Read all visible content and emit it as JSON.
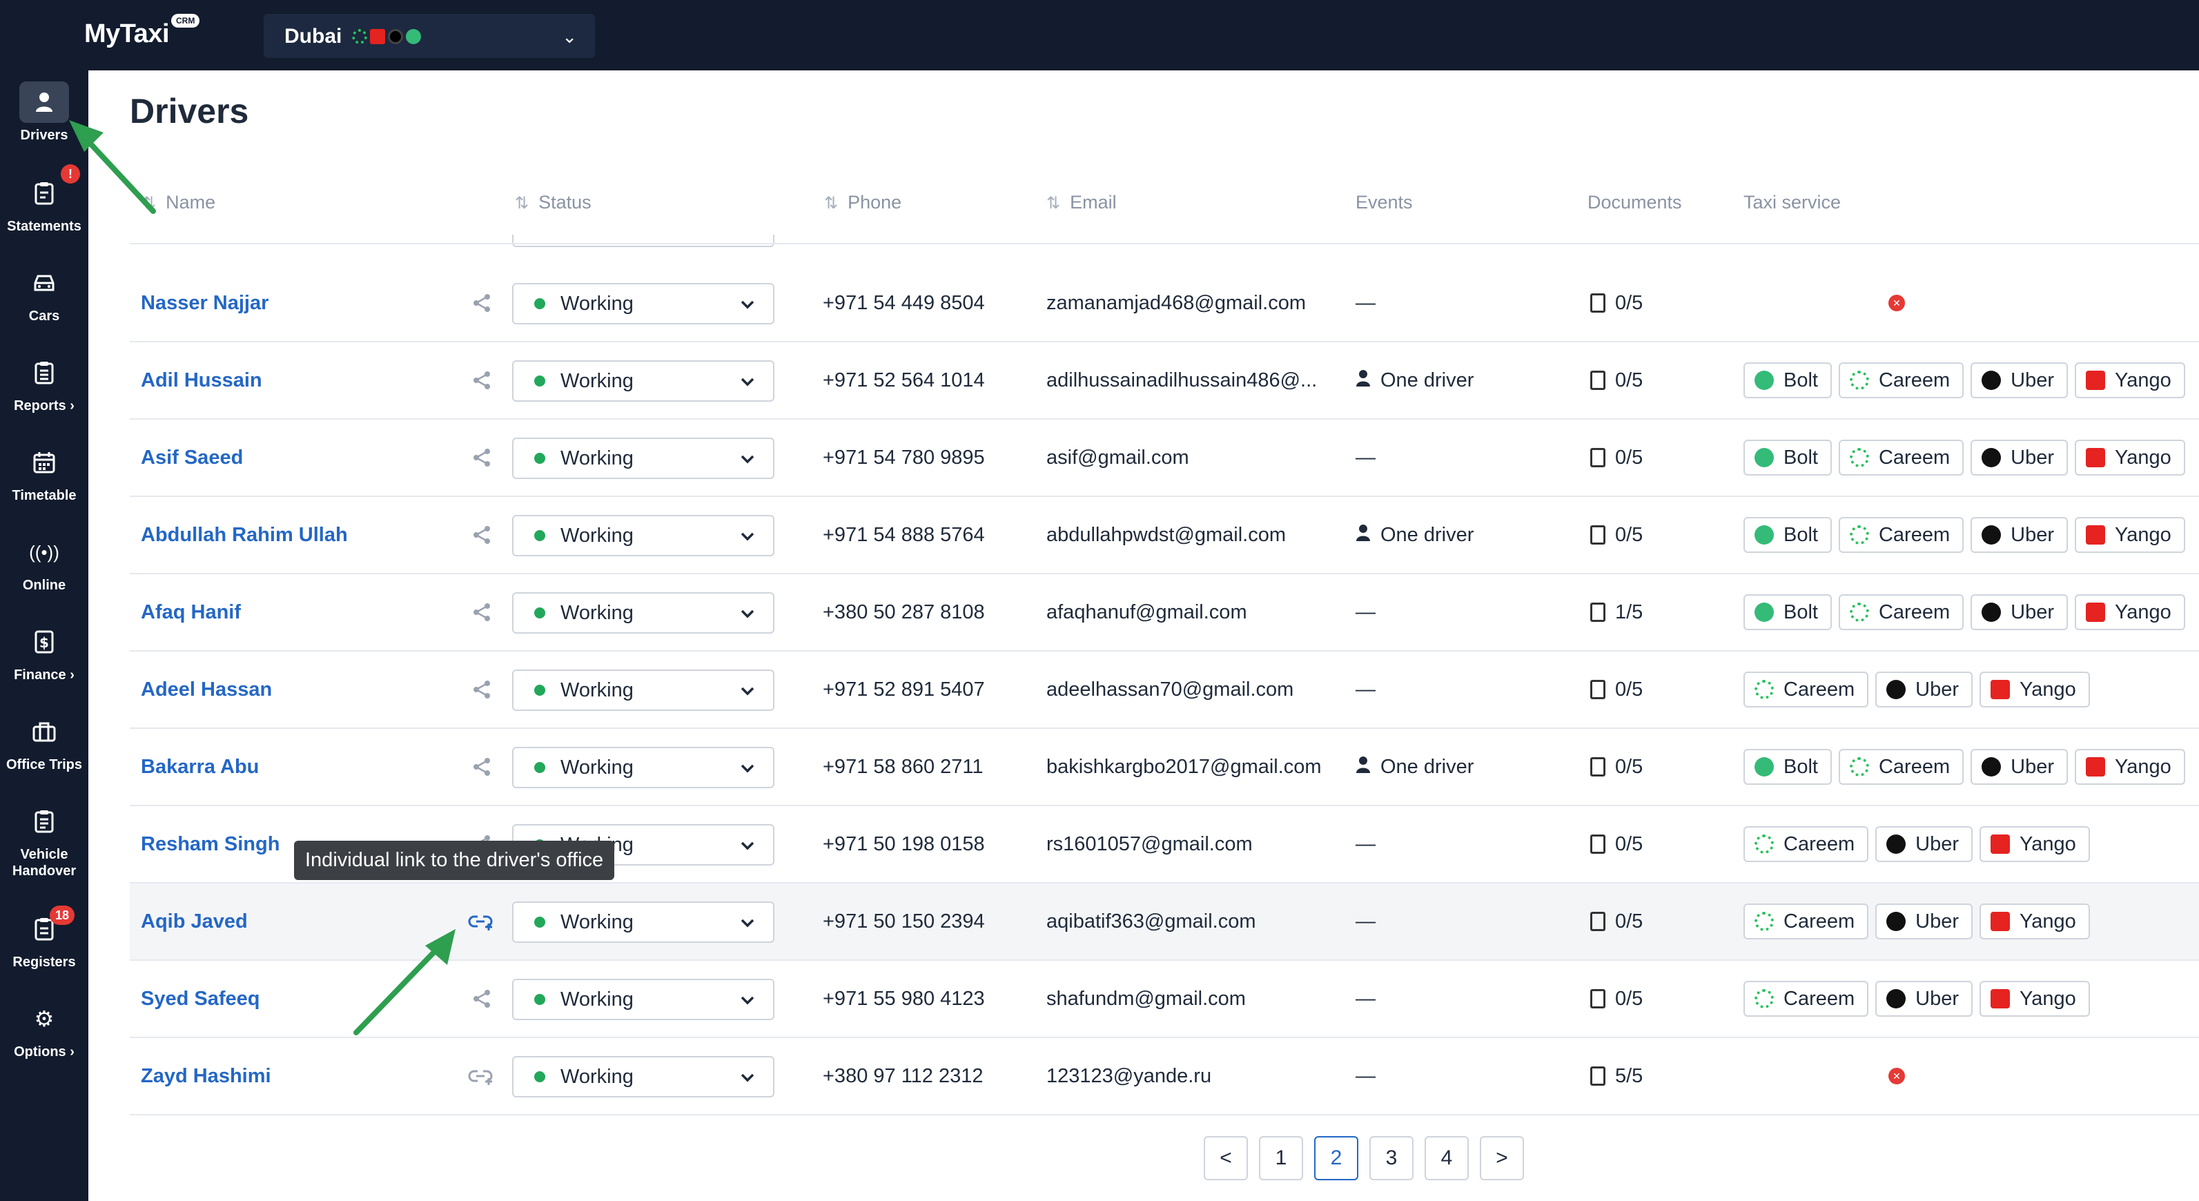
{
  "app": {
    "name": "MyTaxi",
    "badge": "CRM"
  },
  "city_selector": {
    "value": "Dubai"
  },
  "sidebar": {
    "items": [
      {
        "label": "Drivers",
        "icon": "person-icon"
      },
      {
        "label": "Statements",
        "icon": "clipboard-icon",
        "badge": "!"
      },
      {
        "label": "Cars",
        "icon": "car-icon"
      },
      {
        "label": "Reports ›",
        "icon": "report-icon"
      },
      {
        "label": "Timetable",
        "icon": "calendar-icon"
      },
      {
        "label": "Online",
        "icon": "broadcast-icon"
      },
      {
        "label": "Finance ›",
        "icon": "dollar-doc-icon"
      },
      {
        "label": "Office Trips",
        "icon": "briefcase-icon"
      },
      {
        "label": "Vehicle Handover",
        "icon": "clipboard-list-icon"
      },
      {
        "label": "Registers",
        "icon": "register-icon",
        "badge": "18"
      },
      {
        "label": "Options ›",
        "icon": "gear-icon"
      }
    ]
  },
  "page": {
    "title": "Drivers"
  },
  "table": {
    "headers": {
      "name": "Name",
      "status": "Status",
      "phone": "Phone",
      "email": "Email",
      "events": "Events",
      "documents": "Documents",
      "taxi": "Taxi service"
    },
    "rows": [
      {
        "name": "Nasser Najjar",
        "status": "Working",
        "phone": "+971 54 449 8504",
        "email": "zamanamjad468@gmail.com",
        "events": "—",
        "docs": "0/5",
        "services": []
      },
      {
        "name": "Adil Hussain",
        "status": "Working",
        "phone": "+971 52 564 1014",
        "email": "adilhussainadilhussain486@...",
        "events": "One driver",
        "docs": "0/5",
        "services": [
          "Bolt",
          "Careem",
          "Uber",
          "Yango"
        ]
      },
      {
        "name": "Asif Saeed",
        "status": "Working",
        "phone": "+971 54 780 9895",
        "email": "asif@gmail.com",
        "events": "—",
        "docs": "0/5",
        "services": [
          "Bolt",
          "Careem",
          "Uber",
          "Yango"
        ]
      },
      {
        "name": "Abdullah Rahim Ullah",
        "status": "Working",
        "phone": "+971 54 888 5764",
        "email": "abdullahpwdst@gmail.com",
        "events": "One driver",
        "docs": "0/5",
        "services": [
          "Bolt",
          "Careem",
          "Uber",
          "Yango"
        ]
      },
      {
        "name": "Afaq Hanif",
        "status": "Working",
        "phone": "+380 50 287 8108",
        "email": "afaqhanuf@gmail.com",
        "events": "—",
        "docs": "1/5",
        "services": [
          "Bolt",
          "Careem",
          "Uber",
          "Yango"
        ]
      },
      {
        "name": "Adeel Hassan",
        "status": "Working",
        "phone": "+971 52 891 5407",
        "email": "adeelhassan70@gmail.com",
        "events": "—",
        "docs": "0/5",
        "services": [
          "Careem",
          "Uber",
          "Yango"
        ]
      },
      {
        "name": "Bakarra Abu",
        "status": "Working",
        "phone": "+971 58 860 2711",
        "email": "bakishkargbo2017@gmail.com",
        "events": "One driver",
        "docs": "0/5",
        "services": [
          "Bolt",
          "Careem",
          "Uber",
          "Yango"
        ]
      },
      {
        "name": "Resham Singh",
        "status": "Working",
        "phone": "+971 50 198 0158",
        "email": "rs1601057@gmail.com",
        "events": "—",
        "docs": "0/5",
        "services": [
          "Careem",
          "Uber",
          "Yango"
        ]
      },
      {
        "name": "Aqib Javed",
        "status": "Working",
        "phone": "+971 50 150 2394",
        "email": "aqibatif363@gmail.com",
        "events": "—",
        "docs": "0/5",
        "services": [
          "Careem",
          "Uber",
          "Yango"
        ]
      },
      {
        "name": "Syed Safeeq",
        "status": "Working",
        "phone": "+971 55 980 4123",
        "email": "shafundm@gmail.com",
        "events": "—",
        "docs": "0/5",
        "services": [
          "Careem",
          "Uber",
          "Yango"
        ]
      },
      {
        "name": "Zayd Hashimi",
        "status": "Working",
        "phone": "+380 97 112 2312",
        "email": "123123@yande.ru",
        "events": "—",
        "docs": "5/5",
        "services": []
      }
    ]
  },
  "tooltip": {
    "text": "Individual link to the driver's office"
  },
  "pagination": {
    "prev": "<",
    "next": ">",
    "pages": [
      "1",
      "2",
      "3",
      "4"
    ],
    "current": "2"
  },
  "colors": {
    "sidebar_bg": "#121c2e",
    "link": "#2467c6",
    "status_dot": "#22a85a",
    "annotation_arrow": "#2e9e4f"
  }
}
